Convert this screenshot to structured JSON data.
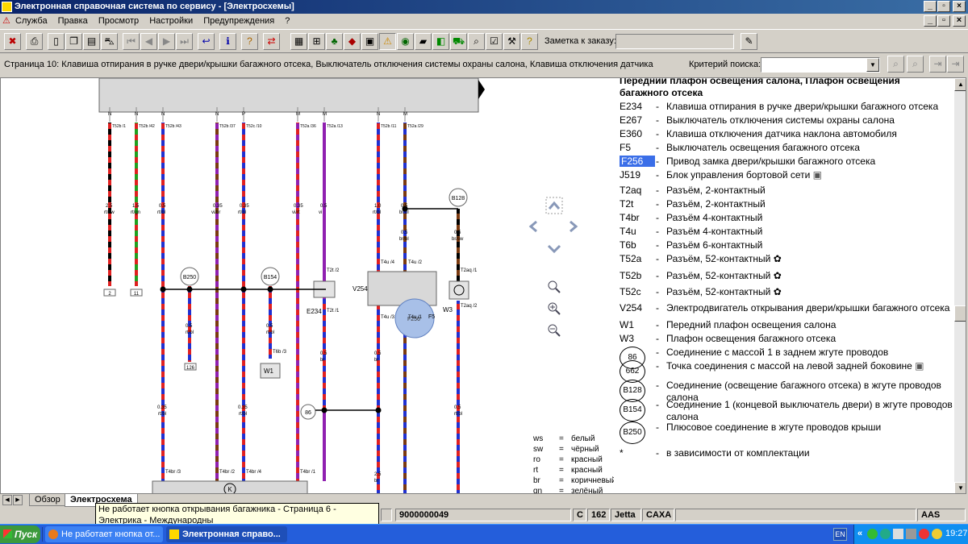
{
  "window": {
    "title": "Электронная справочная система по сервису - [Электросхемы]"
  },
  "menu": [
    "Служба",
    "Правка",
    "Просмотр",
    "Настройки",
    "Предупреждения",
    "?"
  ],
  "toolbar": {
    "order_note_label": "Заметка к заказу:",
    "order_note_value": ""
  },
  "page_header": {
    "text": "Страница 10: Клавиша отпирания в ручке двери/крышки багажного отсека, Выключатель отключения системы охраны салона, Клавиша отключения датчика",
    "search_label": "Критерий поиска:",
    "search_value": ""
  },
  "diagram": {
    "wires": [
      {
        "pin": "N",
        "conn": "T52b /1",
        "gauge": "2.5",
        "color": "rt/sw",
        "dest": "2"
      },
      {
        "pin": "N",
        "conn": "T52b /42",
        "gauge": "1.5",
        "color": "rt/gn",
        "dest": "11"
      },
      {
        "pin": "N",
        "conn": "T52b /43",
        "gauge": "0.5",
        "color": "rt/bl"
      },
      {
        "pin": "N",
        "conn": "T52b /37",
        "gauge": "0.35",
        "color": "vi/br"
      },
      {
        "pin": "P",
        "conn": "T52c /10",
        "gauge": "0.35",
        "color": "rt/bl"
      },
      {
        "pin": "M",
        "conn": "T52a /36",
        "gauge": "0.35",
        "color": "vi/rt"
      },
      {
        "pin": "M",
        "conn": "T52a /13",
        "gauge": "0.5",
        "color": "vi"
      },
      {
        "pin": "N",
        "conn": "T52b /11",
        "gauge": "1.0",
        "color": "rt/bl"
      },
      {
        "pin": "M",
        "conn": "T52a /29",
        "gauge": "0.5",
        "color": "br/bl"
      }
    ],
    "labels": {
      "b128": "B128",
      "b250": "B250",
      "b154": "B154",
      "e234": "E234",
      "v254": "V254",
      "w3": "W3",
      "w1": "W1",
      "f256": "F256",
      "f5": "F5",
      "g86": "86",
      "c126": "126",
      "t6b": "T6b /3",
      "t2t": "T2t /2",
      "t2t1": "T2t /1",
      "t4u4": "T4u /4",
      "t4u2": "T4u /2",
      "t4u3": "T4u /3",
      "t4u1": "T4u /1",
      "t2aq1": "T2aq /1",
      "t2aq2": "T2aq /2",
      "t4br3": "T4br /3",
      "t4br2": "T4br /2",
      "t4br4": "T4br /4",
      "t4br1": "T4br /1",
      "k": "K",
      "w1g": "0.5",
      "w1c": "rt/bl",
      "w3g": "0.5",
      "w3c": "rt/bl",
      "e1g": "0.5",
      "e1c": "br",
      "e2g": "0.5",
      "e2c": "br",
      "e3g": "0.5",
      "e3c": "br/bl",
      "e4g": "0.5",
      "e4c": "br/sw",
      "e5g": "0.35",
      "e5c": "rt/bl",
      "e6g": "0.35",
      "e6c": "rt/bl",
      "e7g": "0.5",
      "e7c": "rt/bl",
      "e8g": "2.5",
      "e8c": "br"
    },
    "color_key": [
      {
        "code": "ws",
        "name": "белый"
      },
      {
        "code": "sw",
        "name": "чёрный"
      },
      {
        "code": "ro",
        "name": "красный"
      },
      {
        "code": "rt",
        "name": "красный"
      },
      {
        "code": "br",
        "name": "коричневый"
      },
      {
        "code": "gn",
        "name": "зелёный"
      }
    ]
  },
  "legend": {
    "heading": "Передний плафон освещения салона, Плафон освещения багажного отсека",
    "items": [
      {
        "code": "E234",
        "desc": "Клавиша отпирания в ручке двери/крышки багажного отсека"
      },
      {
        "code": "E267",
        "desc": "Выключатель отключения системы охраны салона"
      },
      {
        "code": "E360",
        "desc": "Клавиша отключения датчика наклона автомобиля"
      },
      {
        "code": "F5",
        "desc": "Выключатель освещения багажного отсека"
      },
      {
        "code": "F256",
        "desc": "Привод замка двери/крышки багажного отсека"
      },
      {
        "code": "J519",
        "desc": "Блок управления бортовой сети"
      },
      {
        "code": "T2aq",
        "desc": "Разъём, 2-контактный"
      },
      {
        "code": "T2t",
        "desc": "Разъём, 2-контактный"
      },
      {
        "code": "T4br",
        "desc": "Разъём 4-контактный"
      },
      {
        "code": "T4u",
        "desc": "Разъём 4-контактный"
      },
      {
        "code": "T6b",
        "desc": "Разъём 6-контактный"
      },
      {
        "code": "T52a",
        "desc": "Разъём, 52-контактный"
      },
      {
        "code": "T52b",
        "desc": "Разъём, 52-контактный"
      },
      {
        "code": "T52c",
        "desc": "Разъём, 52-контактный"
      },
      {
        "code": "V254",
        "desc": "Электродвигатель открывания двери/крышки багажного отсека"
      },
      {
        "code": "W1",
        "desc": "Передний плафон освещения салона"
      },
      {
        "code": "W3",
        "desc": "Плафон освещения багажного отсека"
      },
      {
        "code": "86",
        "desc": "Соединение с массой 1 в заднем жгуте проводов"
      },
      {
        "code": "662",
        "desc": "Точка соединения с массой на левой задней боковине"
      },
      {
        "code": "B128",
        "desc": "Соединение (освещение багажного отсека) в жгуте проводов салона"
      },
      {
        "code": "B154",
        "desc": "Соединение 1 (концевой выключатель двери) в жгуте проводов салона"
      },
      {
        "code": "B250",
        "desc": "Плюсовое соединение в жгуте проводов крыши"
      },
      {
        "code": "*",
        "desc": "в зависимости от комплектации"
      }
    ]
  },
  "tabs": [
    "Обзор",
    "Электросхема"
  ],
  "status": {
    "order_no": "9000000049",
    "c": "C",
    "n162": "162",
    "model": "Jetta",
    "engine": "CAXA",
    "aas": "AAS"
  },
  "tooltip": "Не работает кнопка открывания багажника - Страница 6 - Электрика - Международны",
  "taskbar": {
    "start": "Пуск",
    "tasks": [
      "Не работает кнопка от...",
      "Электронная справо..."
    ],
    "lang": "EN",
    "clock": "19:27"
  }
}
